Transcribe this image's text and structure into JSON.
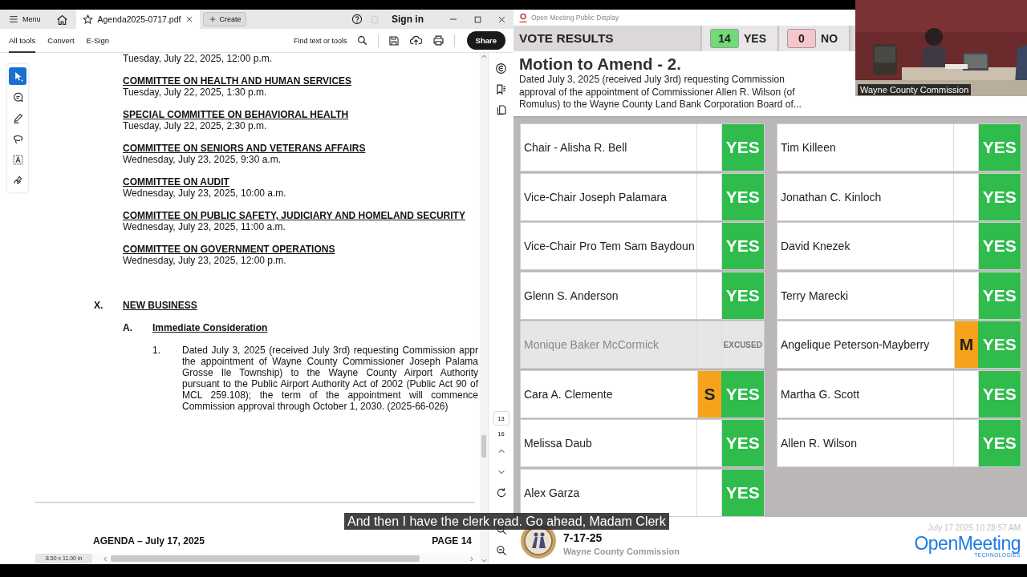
{
  "pdf_viewer": {
    "menu_label": "Menu",
    "tab_title": "Agenda2025-0717.pdf",
    "create_label": "Create",
    "sign_in": "Sign in",
    "tool_tabs": [
      {
        "label": "All tools",
        "selected": true
      },
      {
        "label": "Convert",
        "selected": false
      },
      {
        "label": "E-Sign",
        "selected": false
      }
    ],
    "find_label": "Find text or tools",
    "share_label": "Share",
    "tools": [
      {
        "kind": "select",
        "selected": true
      },
      {
        "kind": "comment",
        "selected": false
      },
      {
        "kind": "draw",
        "selected": false
      },
      {
        "kind": "lasso",
        "selected": false
      },
      {
        "kind": "textbox",
        "selected": false
      },
      {
        "kind": "sign",
        "selected": false
      }
    ],
    "document": {
      "top_line": "Tuesday, July 22, 2025, 12:00 p.m.",
      "committees": [
        {
          "heading": "COMMITTEE ON HEALTH AND HUMAN SERVICES",
          "time": "Tuesday, July 22, 2025, 1:30 p.m."
        },
        {
          "heading": "SPECIAL COMMITTEE ON BEHAVIORAL HEALTH",
          "time": "Tuesday, July 22, 2025, 2:30 p.m."
        },
        {
          "heading": "COMMITTEE ON SENIORS AND VETERANS AFFAIRS",
          "time": "Wednesday, July 23, 2025, 9:30 a.m."
        },
        {
          "heading": "COMMITTEE ON AUDIT",
          "time": "Wednesday, July 23, 2025, 10:00 a.m."
        },
        {
          "heading": "COMMITTEE ON PUBLIC SAFETY, JUDICIARY AND HOMELAND SECURITY",
          "time": "Wednesday, July 23, 2025, 11:00 a.m."
        },
        {
          "heading": "COMMITTEE ON GOVERNMENT OPERATIONS",
          "time": "Wednesday, July 23, 2025, 12:00 p.m."
        }
      ],
      "section": {
        "number": "X.",
        "title": "NEW BUSINESS"
      },
      "subsection": {
        "letter": "A.",
        "title": "Immediate Consideration"
      },
      "item": {
        "number": "1.",
        "lines": [
          "Dated July 3, 2025 (received July 3rd) requesting Commission appr",
          "the appointment of Wayne County Commissioner Joseph Palama",
          "Grosse Ile Township) to the Wayne County Airport Authority",
          "pursuant to the Public Airport Authority Act of 2002 (Public Act 90 of",
          "MCL 259.108); the term of the appointment will commence",
          "Commission approval through October 1, 2030. (2025-66-026)"
        ]
      },
      "footer_left": "AGENDA – July 17, 2025",
      "footer_right": "PAGE 14"
    },
    "current_page": "13",
    "page_count": "16",
    "page_size": "8.50 x 11.00 in"
  },
  "vote_display": {
    "app_title": "Open Meeting Public Display",
    "header": "VOTE RESULTS",
    "tallies": [
      {
        "count": "14",
        "label": "YES",
        "color": "#6fdc78"
      },
      {
        "count": "0",
        "label": "NO",
        "color": "#f7c6cc"
      }
    ],
    "motion_title": "Motion to Amend - 2.",
    "motion_text": "Dated July 3, 2025 (received July 3rd) requesting Commission approval of the appointment of Commissioner Allen R. Wilson (of Romulus) to the Wayne County Land Bank Corporation Board of...",
    "columns": [
      [
        {
          "name": "Chair - Alisha R. Bell",
          "vote": "YES",
          "excused": false
        },
        {
          "name": "Vice-Chair Joseph Palamara",
          "vote": "YES",
          "excused": false
        },
        {
          "name": "Vice-Chair Pro Tem Sam Baydoun",
          "vote": "YES",
          "excused": false
        },
        {
          "name": "Glenn S. Anderson",
          "vote": "YES",
          "excused": false
        },
        {
          "name": "Monique Baker McCormick",
          "vote": "EXCUSED",
          "excused": true
        },
        {
          "name": "Cara A. Clemente",
          "vote": "YES",
          "excused": false,
          "flag": "S"
        },
        {
          "name": "Melissa Daub",
          "vote": "YES",
          "excused": false
        },
        {
          "name": "Alex Garza",
          "vote": "YES",
          "excused": false
        }
      ],
      [
        {
          "name": "Tim Killeen",
          "vote": "YES",
          "excused": false
        },
        {
          "name": "Jonathan C. Kinloch",
          "vote": "YES",
          "excused": false
        },
        {
          "name": "David Knezek",
          "vote": "YES",
          "excused": false
        },
        {
          "name": "Terry Marecki",
          "vote": "YES",
          "excused": false
        },
        {
          "name": "Angelique Peterson-Mayberry",
          "vote": "YES",
          "excused": false,
          "flag": "M"
        },
        {
          "name": "Martha G. Scott",
          "vote": "YES",
          "excused": false
        },
        {
          "name": "Allen R.  Wilson",
          "vote": "YES",
          "excused": false
        }
      ]
    ],
    "footer": {
      "date": "7-17-25",
      "org": "Wayne County Commission",
      "timestamp": "July 17 2025 10:28:57 AM",
      "brand": "OpenMeeting",
      "brand_sub": "TECHNOLOGIES"
    }
  },
  "video": {
    "caption": "Wayne County Commission"
  },
  "subtitle": "And then I have the clerk read. Go ahead, Madam Clerk"
}
